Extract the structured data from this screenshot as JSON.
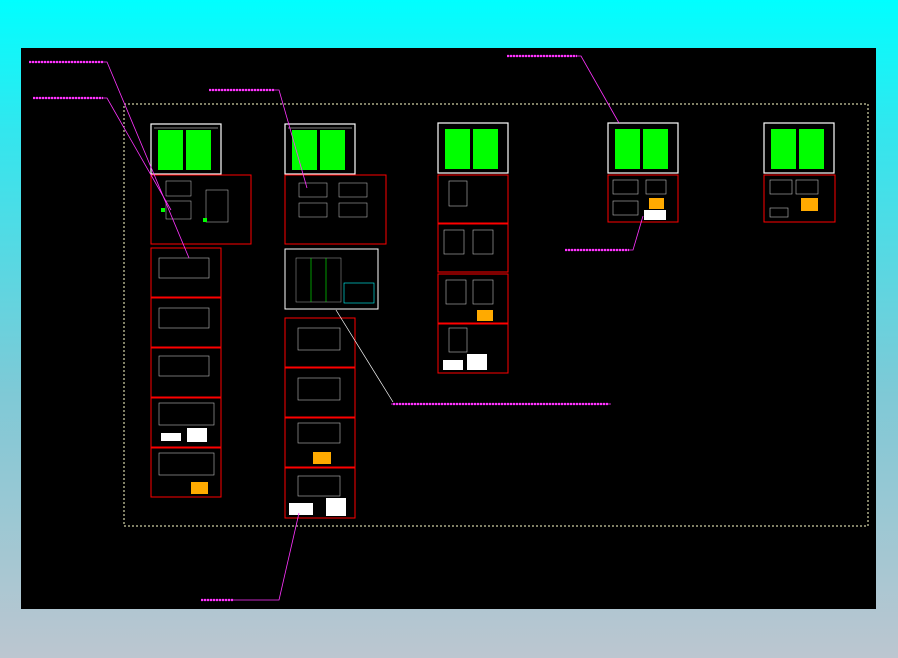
{
  "drawing": {
    "background": "#000000",
    "outer_background": "#00ffff",
    "frame_color": "#ff0000",
    "title_block_color": "#00ff00",
    "leader_color": "#ff33ff",
    "stamp_color": "#ffaa00",
    "boundary_color": "#ffffcc"
  }
}
